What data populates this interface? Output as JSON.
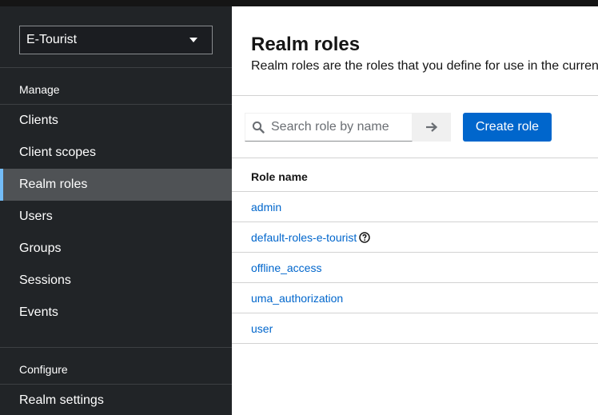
{
  "sidebar": {
    "realm_selector": "E-Tourist",
    "manage_title": "Manage",
    "manage_items": [
      {
        "label": "Clients"
      },
      {
        "label": "Client scopes"
      },
      {
        "label": "Realm roles"
      },
      {
        "label": "Users"
      },
      {
        "label": "Groups"
      },
      {
        "label": "Sessions"
      },
      {
        "label": "Events"
      }
    ],
    "active_item": "Realm roles",
    "configure_title": "Configure",
    "configure_items": [
      {
        "label": "Realm settings"
      }
    ]
  },
  "main": {
    "title": "Realm roles",
    "description": "Realm roles are the roles that you define for use in the current realm.",
    "search": {
      "placeholder": "Search role by name",
      "value": ""
    },
    "create_button": "Create role",
    "table": {
      "column_header": "Role name",
      "rows": [
        {
          "name": "admin"
        },
        {
          "name": "default-roles-e-tourist",
          "has_help_icon": true
        },
        {
          "name": "offline_access"
        },
        {
          "name": "uma_authorization"
        },
        {
          "name": "user"
        }
      ]
    }
  },
  "icons": {
    "search": "search-icon",
    "arrow": "arrow-right-icon",
    "help": "question-circle-icon",
    "caret": "caret-down-icon"
  },
  "colors": {
    "sidebar_bg": "#212427",
    "active_bg": "#4f5255",
    "active_indicator": "#73bcf7",
    "primary": "#0066cc"
  }
}
